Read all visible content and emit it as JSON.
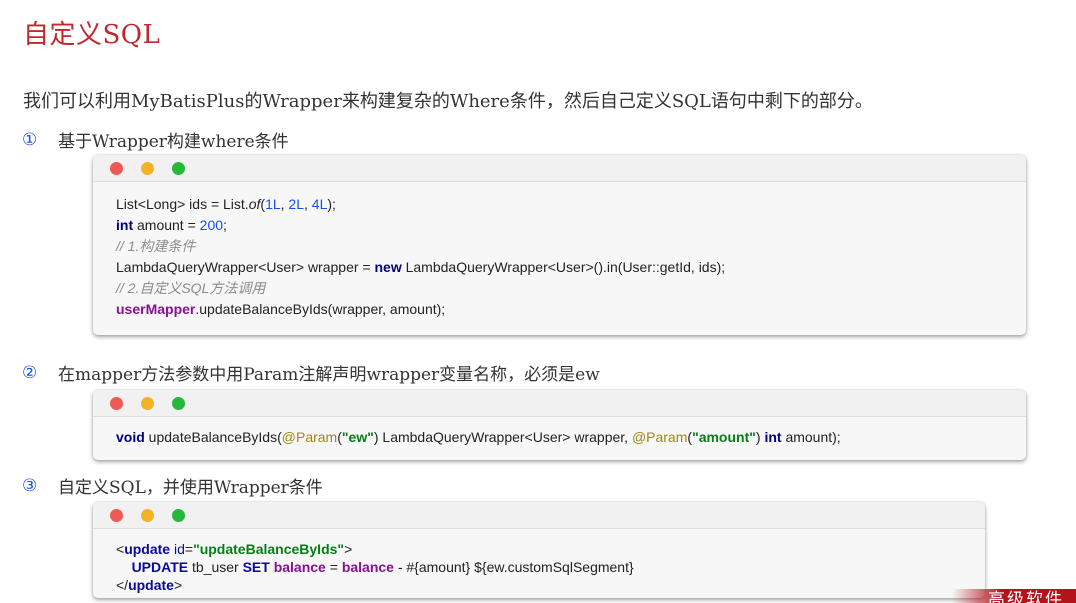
{
  "title": "自定义SQL",
  "intro": "我们可以利用MyBatisPlus的Wrapper来构建复杂的Where条件，然后自己定义SQL语句中剩下的部分。",
  "steps": [
    {
      "num": "①",
      "text": "基于Wrapper构建where条件"
    },
    {
      "num": "②",
      "text": "在mapper方法参数中用Param注解声明wrapper变量名称，必须是ew"
    },
    {
      "num": "③",
      "text": "自定义SQL，并使用Wrapper条件"
    }
  ],
  "code1": {
    "l1": {
      "a": "List<Long> ids = List.",
      "of": "of",
      "b": "(",
      "n1": "1L",
      "c1": ", ",
      "n2": "2L",
      "c2": ", ",
      "n3": "4L",
      "d": ");"
    },
    "l2": {
      "kw": "int",
      "a": " amount = ",
      "n": "200",
      "b": ";"
    },
    "l3": "// 1.构建条件",
    "l4": {
      "a": "LambdaQueryWrapper<User> wrapper = ",
      "kw": "new",
      "b": " LambdaQueryWrapper<User>().in(User::getId, ids);"
    },
    "l5": "// 2.自定义SQL方法调用",
    "l6": {
      "field": "userMapper",
      "a": ".updateBalanceByIds(wrapper, amount);"
    }
  },
  "code2": {
    "kw1": "void",
    "a": " updateBalanceByIds(",
    "an1": "@Param",
    "p1": "(",
    "s1": "\"ew\"",
    "p2": ")",
    "b": " LambdaQueryWrapper<User> wrapper, ",
    "an2": "@Param",
    "p3": "(",
    "s2": "\"amount\"",
    "p4": ")",
    "kw2": " int",
    "c": " amount);"
  },
  "code3": {
    "l1": {
      "lt": "<",
      "tag": "update",
      "sp": " ",
      "attr": "id",
      "eq": "=",
      "val": "\"updateBalanceByIds\"",
      "gt": ">"
    },
    "l2": {
      "indent": "    ",
      "k1": "UPDATE",
      "a": " tb_user ",
      "k2": "SET",
      "f1": " balance",
      "b": " = ",
      "f2": "balance",
      "c": " - #{amount} ${ew.customSqlSegment}"
    },
    "l3": {
      "lt": "</",
      "tag": "update",
      "gt": ">"
    }
  },
  "brand": "高级软件"
}
